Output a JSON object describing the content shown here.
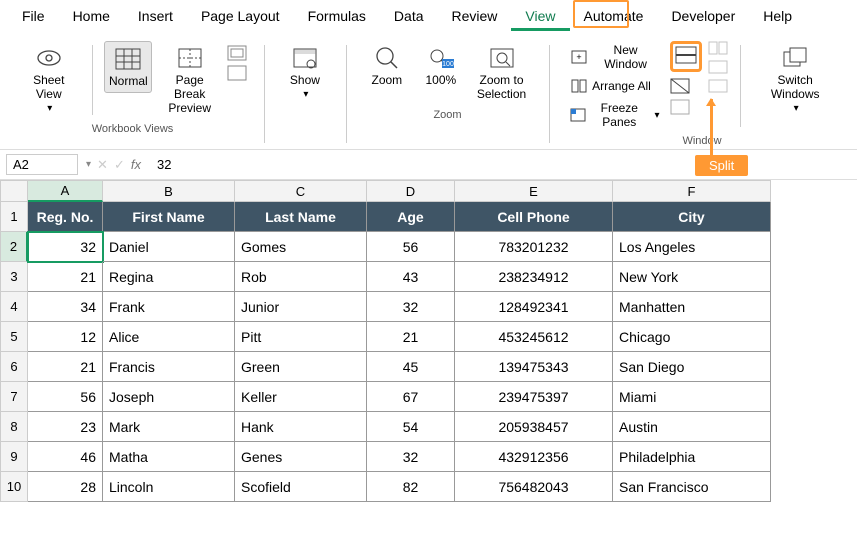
{
  "menu": [
    "File",
    "Home",
    "Insert",
    "Page Layout",
    "Formulas",
    "Data",
    "Review",
    "View",
    "Automate",
    "Developer",
    "Help"
  ],
  "active_menu": "View",
  "ribbon": {
    "sheet_view": "Sheet View",
    "normal": "Normal",
    "page_break": "Page Break Preview",
    "show": "Show",
    "zoom": "Zoom",
    "hundred": "100%",
    "zoom_sel": "Zoom to Selection",
    "new_win": "New Window",
    "arrange": "Arrange All",
    "freeze": "Freeze Panes",
    "switch": "Switch Windows",
    "g_views": "Workbook Views",
    "g_zoom": "Zoom",
    "g_window": "Window"
  },
  "callout": "Split",
  "namebox": "A2",
  "formula_val": "32",
  "cols": [
    "A",
    "B",
    "C",
    "D",
    "E",
    "F"
  ],
  "headers": [
    "Reg. No.",
    "First Name",
    "Last Name",
    "Age",
    "Cell Phone",
    "City"
  ],
  "rows": [
    {
      "n": 2,
      "reg": 32,
      "fn": "Daniel",
      "ln": "Gomes",
      "age": 56,
      "ph": "783201232",
      "city": "Los Angeles"
    },
    {
      "n": 3,
      "reg": 21,
      "fn": "Regina",
      "ln": "Rob",
      "age": 43,
      "ph": "238234912",
      "city": "New York"
    },
    {
      "n": 4,
      "reg": 34,
      "fn": "Frank",
      "ln": "Junior",
      "age": 32,
      "ph": "128492341",
      "city": "Manhatten"
    },
    {
      "n": 5,
      "reg": 12,
      "fn": "Alice",
      "ln": "Pitt",
      "age": 21,
      "ph": "453245612",
      "city": "Chicago"
    },
    {
      "n": 6,
      "reg": 21,
      "fn": "Francis",
      "ln": "Green",
      "age": 45,
      "ph": "139475343",
      "city": "San Diego"
    },
    {
      "n": 7,
      "reg": 56,
      "fn": "Joseph",
      "ln": "Keller",
      "age": 67,
      "ph": "239475397",
      "city": "Miami"
    },
    {
      "n": 8,
      "reg": 23,
      "fn": "Mark",
      "ln": "Hank",
      "age": 54,
      "ph": "205938457",
      "city": "Austin"
    },
    {
      "n": 9,
      "reg": 46,
      "fn": "Matha",
      "ln": "Genes",
      "age": 32,
      "ph": "432912356",
      "city": "Philadelphia"
    },
    {
      "n": 10,
      "reg": 28,
      "fn": "Lincoln",
      "ln": "Scofield",
      "age": 82,
      "ph": "756482043",
      "city": "San Francisco"
    }
  ],
  "selected_cell": "A2"
}
